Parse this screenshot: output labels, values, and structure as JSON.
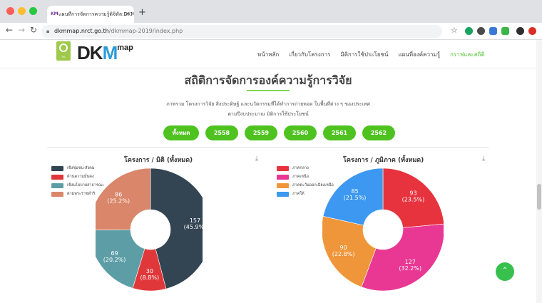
{
  "browser": {
    "tab_title": "แผนที่การจัดการความรู้ดิจิทัล:DKM",
    "tab_icon_text": "KM",
    "url_host": "dkmmap.nrct.go.th",
    "url_path": "/dkmmap-2019/index.php"
  },
  "header": {
    "logo_dk": "DK",
    "logo_m": "M",
    "logo_sup": "map",
    "logo_caption": "วช.",
    "menu": [
      {
        "label": "หน้าหลัก"
      },
      {
        "label": "เกี่ยวกับโครงการ"
      },
      {
        "label": "มิติการใช้ประโยชน์"
      },
      {
        "label": "แผนที่องค์ความรู้"
      },
      {
        "label": "กราฟและสถิติ"
      }
    ]
  },
  "main": {
    "title": "สถิติการจัดการองค์ความรู้การวิจัย",
    "subtitle_line1": "ภาพรวม โครงการวิจัย สิ่งประดิษฐ์ และนวัตกรรมที่ได้ทำการถ่ายทอด ในพื้นที่ต่าง ๆ ของประเทศ",
    "subtitle_line2": "ตามปีงบประมาณ มิติการใช้ประโยชน์",
    "filters": [
      {
        "label": "ทั้งหมด"
      },
      {
        "label": "2558"
      },
      {
        "label": "2559"
      },
      {
        "label": "2560"
      },
      {
        "label": "2561"
      },
      {
        "label": "2562"
      }
    ],
    "download_icon": "download-icon",
    "fab_icon": "chevron-up-icon"
  },
  "chart_data": [
    {
      "type": "pie",
      "title": "โครงการ / มิติ (ทั้งหมด)",
      "categories": [
        "เชิงชุมชน-สังคม",
        "ด้านความมั่นคง",
        "เชิงนโยบายสาธารณะ",
        "ตามพระราชดำริ"
      ],
      "values": [
        157,
        30,
        69,
        86
      ],
      "labels": [
        "157",
        "30",
        "69",
        "86"
      ],
      "percents": [
        "(45.9%)",
        "(8.8%)",
        "(20.2%)",
        "(25.2%)"
      ],
      "colors": [
        "#334452",
        "#e0383a",
        "#5d9ea6",
        "#d9866a"
      ],
      "legend_position": "top-left"
    },
    {
      "type": "pie",
      "title": "โครงการ / ภูมิภาค (ทั้งหมด)",
      "categories": [
        "ภาคกลาง",
        "ภาคเหนือ",
        "ภาคตะวันออกเฉียงเหนือ",
        "ภาคใต้"
      ],
      "values": [
        93,
        127,
        90,
        85
      ],
      "labels": [
        "93",
        "127",
        "90",
        "85"
      ],
      "percents": [
        "(23.5%)",
        "(32.2%)",
        "(22.8%)",
        "(21.5%)"
      ],
      "colors": [
        "#e6333e",
        "#e93894",
        "#f0963a",
        "#3c98f0"
      ],
      "legend_position": "top-left"
    }
  ]
}
